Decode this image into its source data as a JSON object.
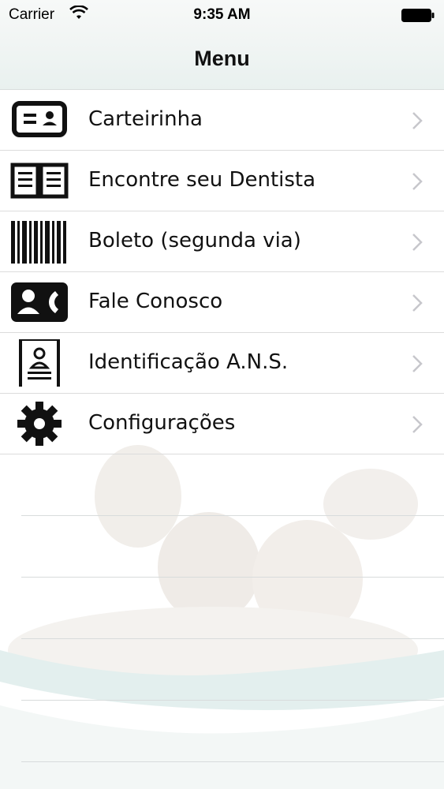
{
  "status_bar": {
    "carrier": "Carrier",
    "time": "9:35 AM",
    "wifi_icon": "wifi-icon",
    "battery_icon": "battery-icon"
  },
  "nav": {
    "title": "Menu"
  },
  "menu": {
    "items": [
      {
        "label": "Carteirinha",
        "icon": "id-card-icon"
      },
      {
        "label": "Encontre seu Dentista",
        "icon": "open-book-icon"
      },
      {
        "label": "Boleto (segunda via)",
        "icon": "barcode-icon"
      },
      {
        "label": "Fale Conosco",
        "icon": "contact-phone-icon"
      },
      {
        "label": "Identificação A.N.S.",
        "icon": "badge-icon"
      },
      {
        "label": "Configurações",
        "icon": "gear-icon"
      }
    ]
  },
  "colors": {
    "icon": "#111111",
    "chevron": "#c7c7cc",
    "separator": "#dcdcdc",
    "nav_background": "#eef3f1"
  }
}
